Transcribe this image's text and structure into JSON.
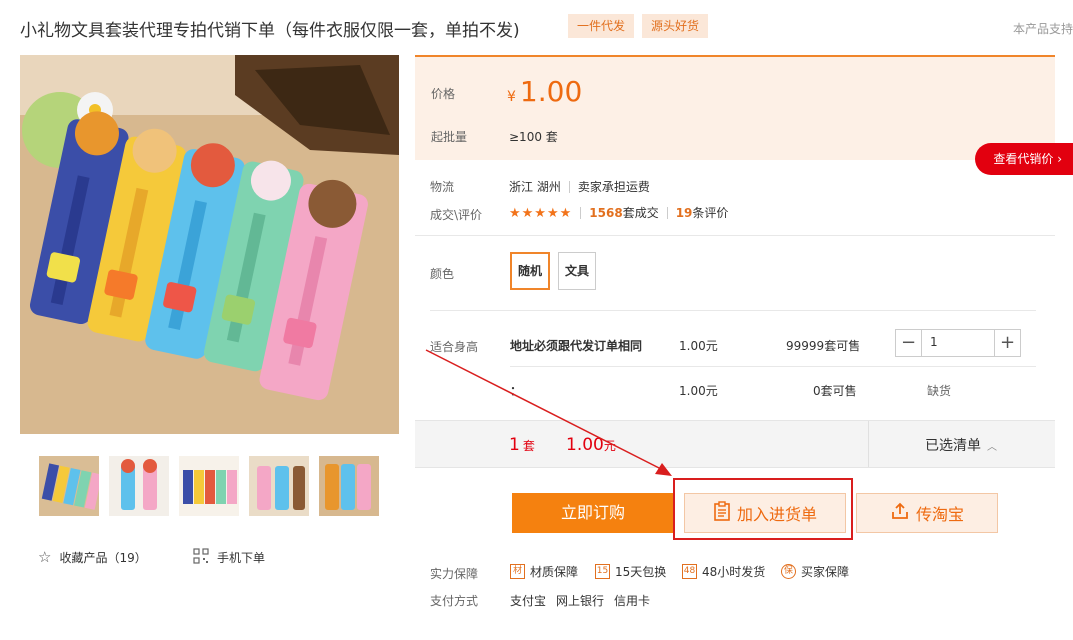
{
  "title": "小礼物文具套装代理专拍代销下单（每件衣服仅限一套，单拍不发)",
  "tags": [
    "一件代发",
    "源头好货"
  ],
  "support_text": "本产品支持",
  "price_box": {
    "price_label": "价格",
    "currency": "¥",
    "price": "1.00",
    "moq_label": "起批量",
    "moq_value": "≥100 套",
    "agent_price_button": "查看代销价 ›"
  },
  "logistics": {
    "label": "物流",
    "origin": "浙江 湖州",
    "shipping": "卖家承担运费"
  },
  "reviews": {
    "label": "成交\\评价",
    "stars": "★★★★★",
    "rating": 5,
    "deals_count": "1568",
    "deals_suffix": "套成交",
    "reviews_count": "19",
    "reviews_suffix": "条评价"
  },
  "color": {
    "label": "颜色",
    "options": [
      {
        "label": "随机",
        "selected": true
      },
      {
        "label": "文具",
        "selected": false
      }
    ]
  },
  "sku_table": {
    "label": "适合身高",
    "rows": [
      {
        "name": "地址必须跟代发订单相同",
        "price": "1.00元",
        "stock_num": "99999",
        "stock_suffix": "套可售",
        "quantity": "1"
      },
      {
        "name": "：",
        "price": "1.00元",
        "stock_num": "0",
        "stock_suffix": "套可售",
        "status": "缺货"
      }
    ]
  },
  "summary": {
    "qty": "1",
    "qty_unit": "套",
    "total": "1.00",
    "total_unit": "元",
    "selected_list": "已选清单"
  },
  "actions": {
    "buy_now": "立即订购",
    "add_to_cart": "加入进货单",
    "to_taobao": "传淘宝"
  },
  "guarantees": {
    "label": "实力保障",
    "items": [
      {
        "icon": "材",
        "text": "材质保障"
      },
      {
        "icon": "15",
        "text": "15天包换"
      },
      {
        "icon": "48",
        "text": "48小时发货"
      },
      {
        "icon": "保",
        "text": "买家保障"
      }
    ]
  },
  "payment": {
    "label": "支付方式",
    "methods": [
      "支付宝",
      "网上银行",
      "信用卡"
    ]
  },
  "left_actions": {
    "favorite": "收藏产品（19）",
    "mobile_order": "手机下单"
  },
  "colors": {
    "accent": "#f5810f",
    "price": "#ee6a10",
    "highlight_box": "#d91e1e",
    "agent_button": "#e2000f"
  }
}
